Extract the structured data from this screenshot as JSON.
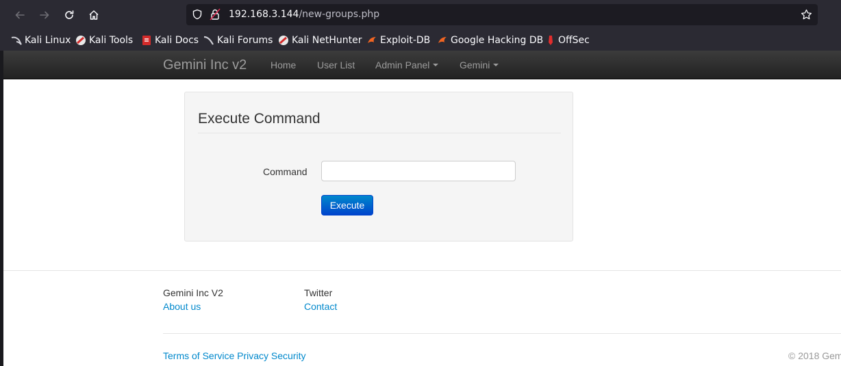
{
  "browser": {
    "url_host": "192.168.3.144",
    "url_path": "/new-groups.php",
    "bookmarks": [
      {
        "label": "Kali Linux"
      },
      {
        "label": "Kali Tools"
      },
      {
        "label": "Kali Docs"
      },
      {
        "label": "Kali Forums"
      },
      {
        "label": "Kali NetHunter"
      },
      {
        "label": "Exploit-DB"
      },
      {
        "label": "Google Hacking DB"
      },
      {
        "label": "OffSec"
      }
    ]
  },
  "site_nav": {
    "brand": "Gemini Inc v2",
    "links": [
      "Home",
      "User List",
      "Admin Panel",
      "Gemini"
    ]
  },
  "form": {
    "title": "Execute Command",
    "command_label": "Command",
    "command_value": "",
    "execute_label": "Execute"
  },
  "footer": {
    "col1_title": "Gemini Inc V2",
    "col1_link": "About us",
    "col2_title": "Twitter",
    "col2_link": "Contact",
    "bottom_links": "Terms of Service Privacy Security",
    "copyright": "© 2018 Gem"
  }
}
